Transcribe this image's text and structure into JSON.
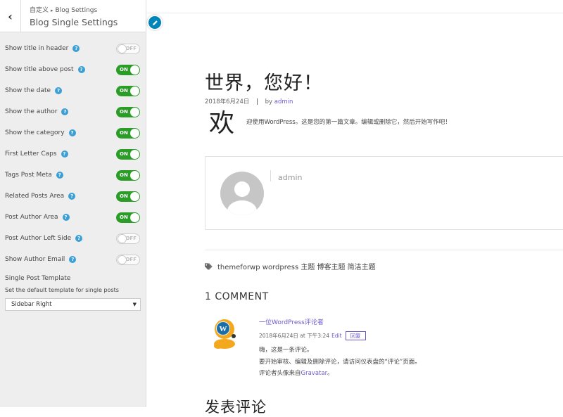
{
  "sidebar": {
    "back_icon": "chevron-left-icon",
    "breadcrumb_parent": "自定义",
    "breadcrumb_sep": "▸",
    "breadcrumb_current": "Blog Settings",
    "title": "Blog Single Settings",
    "settings": [
      {
        "label": "Show title in header",
        "state": "OFF"
      },
      {
        "label": "Show title above post",
        "state": "ON"
      },
      {
        "label": "Show the date",
        "state": "ON"
      },
      {
        "label": "Show the author",
        "state": "ON"
      },
      {
        "label": "Show the category",
        "state": "ON"
      },
      {
        "label": "First Letter Caps",
        "state": "ON"
      },
      {
        "label": "Tags Post Meta",
        "state": "ON"
      },
      {
        "label": "Related Posts Area",
        "state": "ON"
      },
      {
        "label": "Post Author Area",
        "state": "ON"
      },
      {
        "label": "Post Author Left Side",
        "state": "OFF"
      },
      {
        "label": "Show Author Email",
        "state": "OFF"
      }
    ],
    "help_icon_text": "?",
    "template": {
      "title": "Single Post Template",
      "description": "Set the default template for single posts",
      "selected": "Sidebar Right",
      "caret": "▼"
    }
  },
  "preview": {
    "post_title": "世界，您好！",
    "date": "2018年6月24日",
    "separator": "|",
    "by": "by",
    "author": "admin",
    "drop_cap": "欢",
    "excerpt": "迎使用WordPress。这是您的第一篇文章。编辑或删除它，然后开始写作吧！",
    "author_box_name": "admin",
    "tags": "themeforwp wordpress 主题 博客主题 简洁主题",
    "comments_title": "1 COMMENT",
    "comment": {
      "author": "一位WordPress评论者",
      "time": "2018年6月24日 at 下午3:24",
      "edit": "Edit",
      "reply": "回复",
      "line1": "嗨，这是一条评论。",
      "line2": "要开始审核、编辑及删除评论，请访问仪表盘的“评论”页面。",
      "line3_prefix": "评论者头像来自",
      "line3_link": "Gravatar",
      "line3_suffix": "。"
    },
    "leave_reply": "发表评论"
  },
  "colors": {
    "toggle_on": "#2a9d27",
    "help_icon": "#3a9fd6",
    "link": "#6a5acd",
    "edit_pencil": "#0085ba"
  }
}
